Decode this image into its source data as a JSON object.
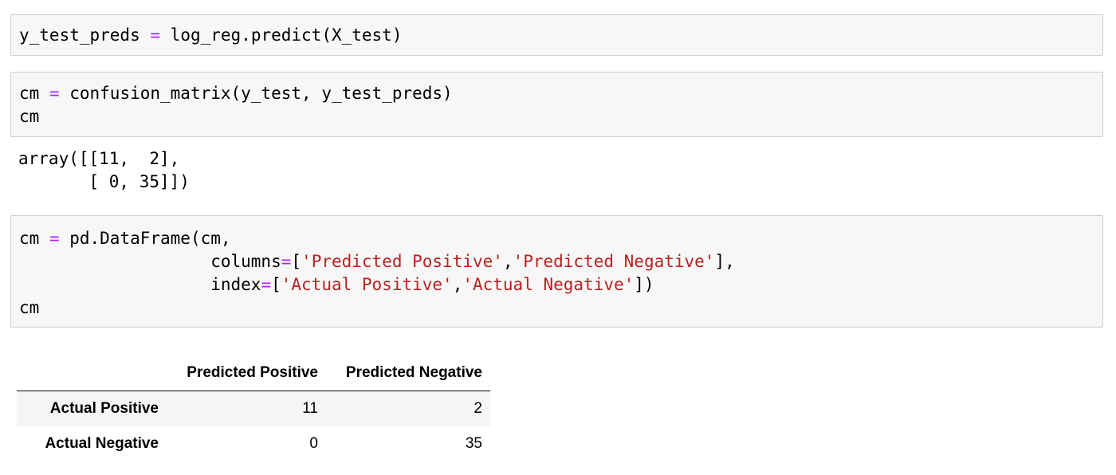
{
  "cells": {
    "cell1": {
      "line1": {
        "a": "y_test_preds ",
        "op": "=",
        "b": " log_reg.predict(X_test)"
      }
    },
    "cell2": {
      "line1": {
        "a": "cm ",
        "op": "=",
        "b": " confusion_matrix(y_test, y_test_preds)"
      },
      "line2": "cm",
      "output_line1": "array([[11,  2],",
      "output_line2": "       [ 0, 35]])"
    },
    "cell3": {
      "line1": {
        "a": "cm ",
        "op": "=",
        "b": " pd.DataFrame(cm,"
      },
      "line2": {
        "indent": "                   ",
        "kw": "columns",
        "op": "=",
        "open": "[",
        "s1": "'Predicted Positive'",
        "comma": ",",
        "s2": "'Predicted Negative'",
        "close": "],"
      },
      "line3": {
        "indent": "                   ",
        "kw": "index",
        "op": "=",
        "open": "[",
        "s1": "'Actual Positive'",
        "comma": ",",
        "s2": "'Actual Negative'",
        "close": "])"
      },
      "line4": "cm"
    }
  },
  "dataframe": {
    "columns": [
      "",
      "Predicted Positive",
      "Predicted Negative"
    ],
    "rows": [
      {
        "index": "Actual Positive",
        "values": [
          "11",
          "2"
        ]
      },
      {
        "index": "Actual Negative",
        "values": [
          "0",
          "35"
        ]
      }
    ]
  },
  "colors": {
    "cell_background": "#f7f7f7",
    "cell_border": "#cfcfcf",
    "operator": "#aa22ff",
    "string": "#ba2121",
    "striped_row": "#f5f5f5"
  }
}
